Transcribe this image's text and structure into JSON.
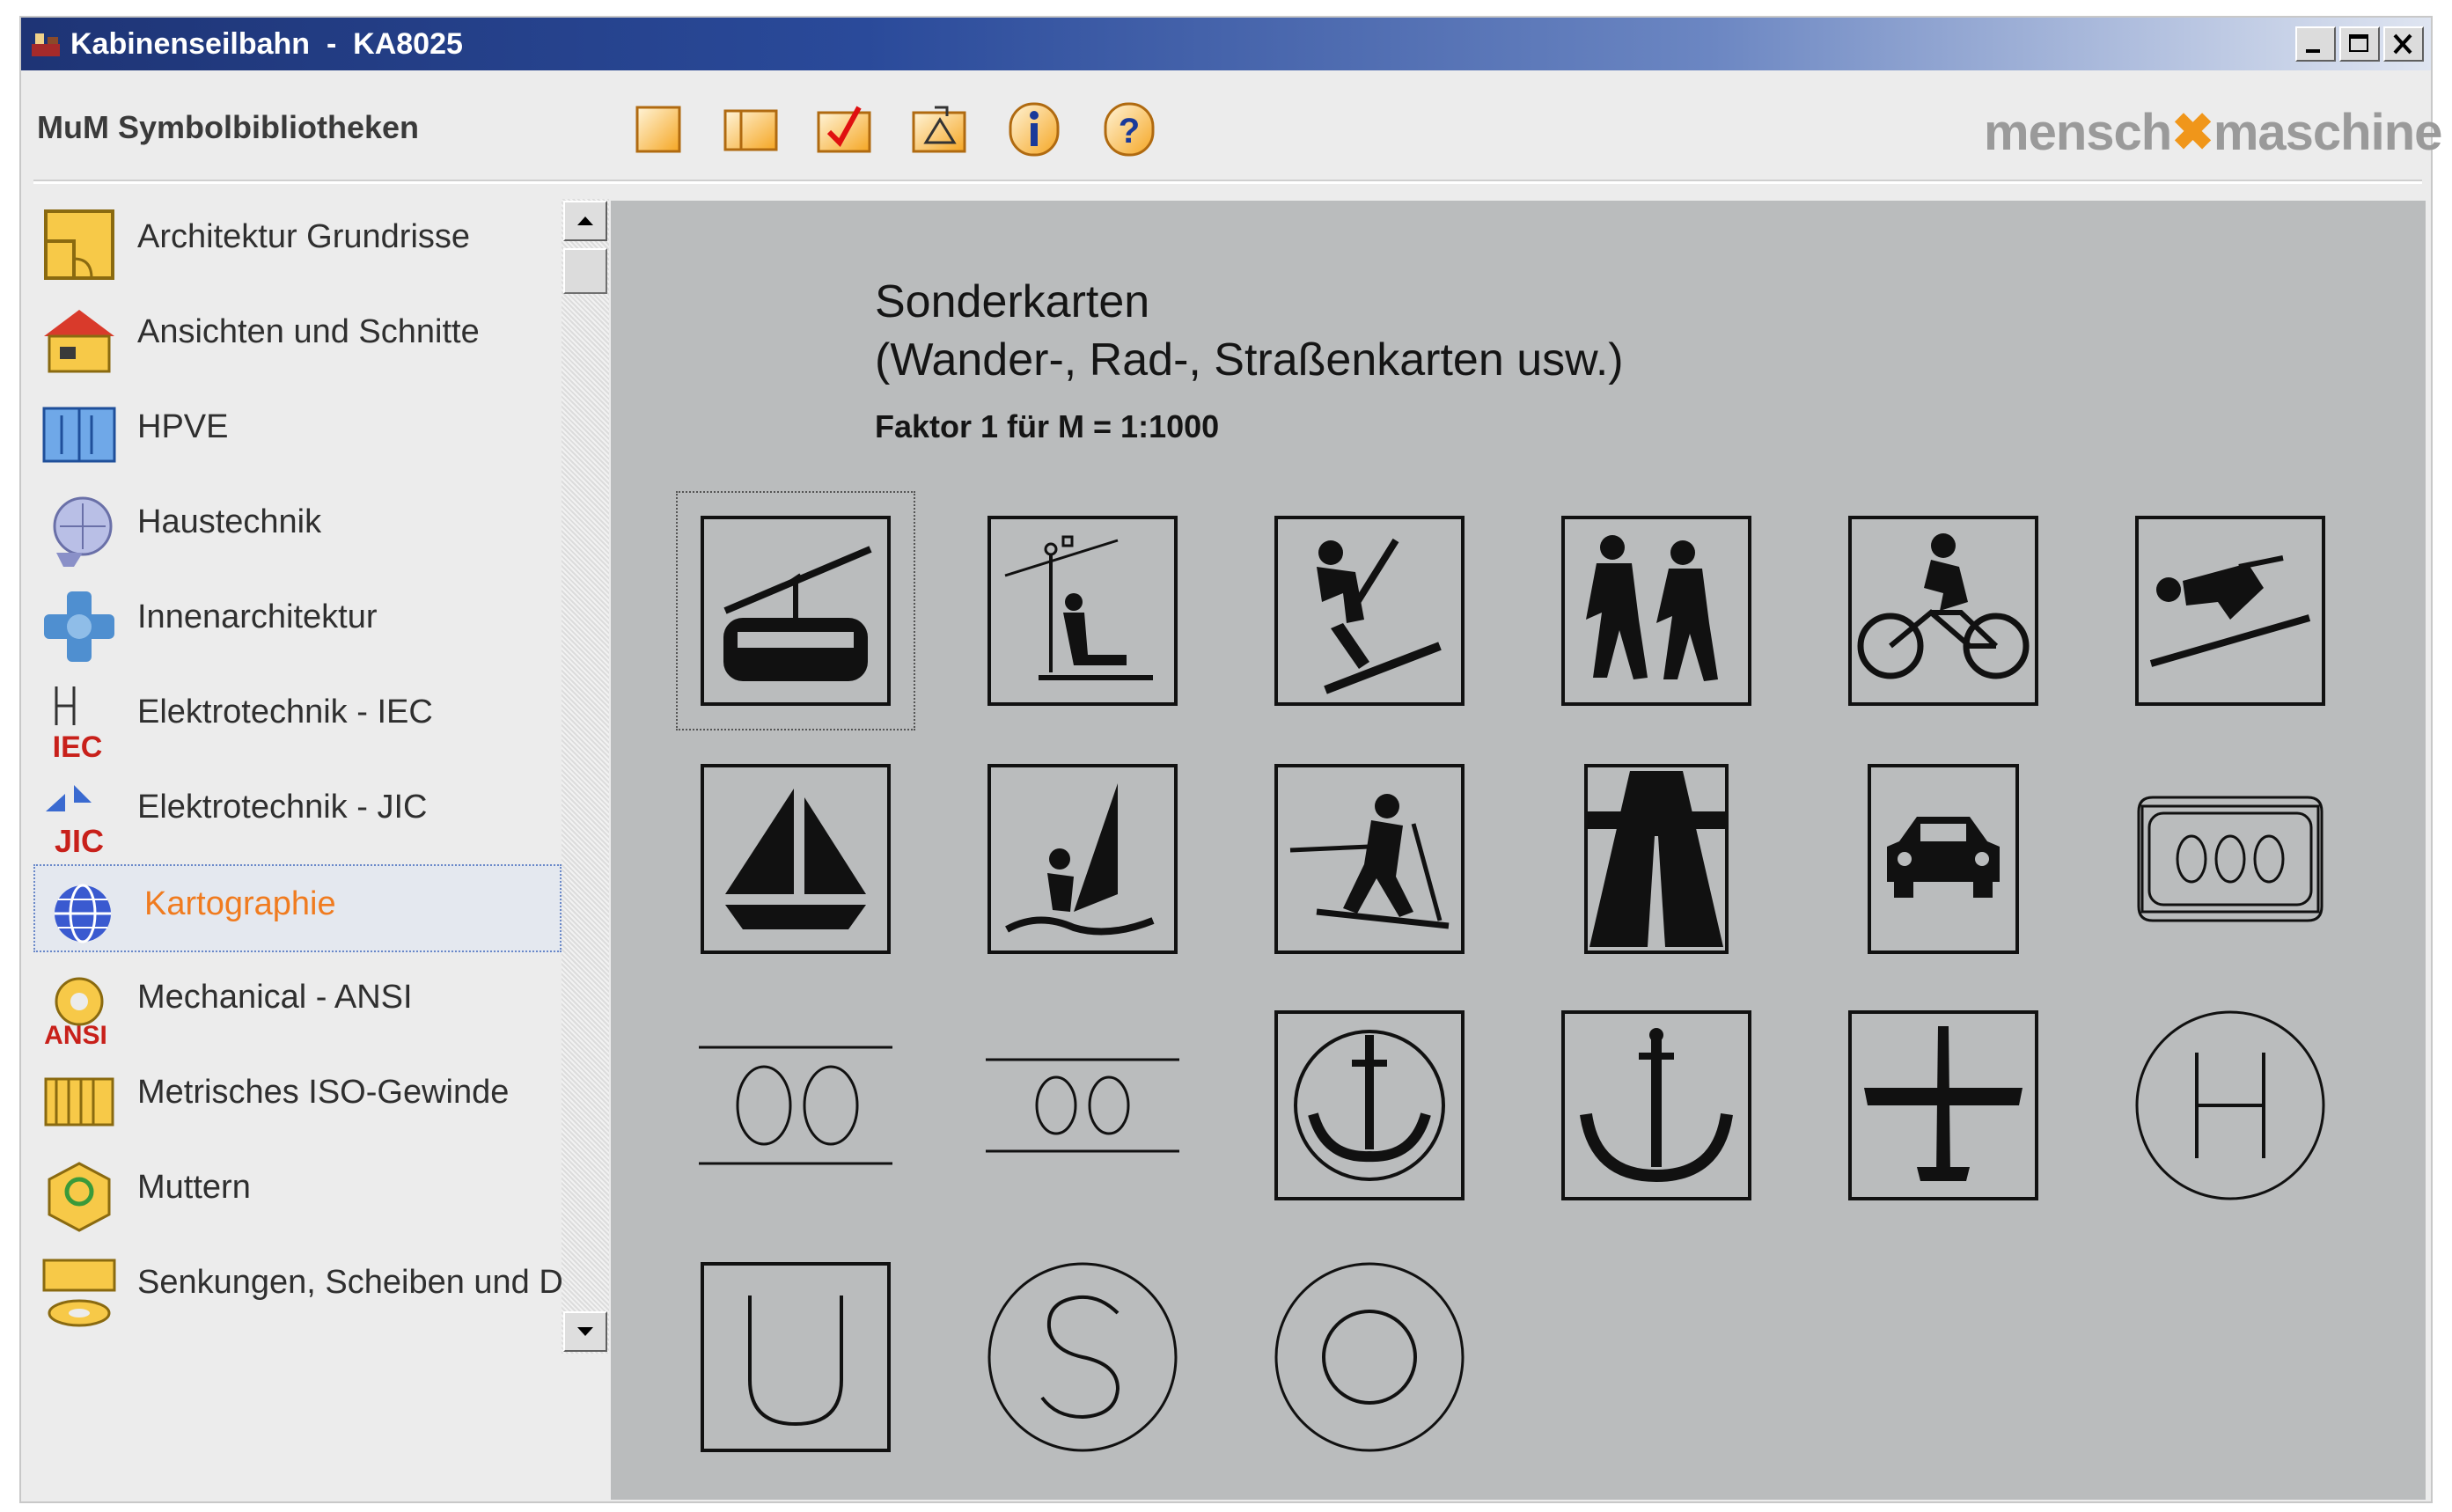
{
  "window": {
    "title": "Kabinenseilbahn  -  KA8025",
    "controls": {
      "minimize_icon": "minimize-icon",
      "maximize_icon": "maximize-icon",
      "close_icon": "close-icon"
    }
  },
  "toolbar": {
    "library_title": "MuM Symbolbibliotheken",
    "buttons": [
      "new-icon",
      "open-icon",
      "check-icon",
      "insert-icon",
      "info-icon",
      "help-icon"
    ],
    "logo_left": "mensch",
    "logo_right": "maschine",
    "accent_color": "#f0961a"
  },
  "sidebar": {
    "items": [
      {
        "label": "Architektur Grundrisse",
        "icon": "floorplan-icon"
      },
      {
        "label": "Ansichten und Schnitte",
        "icon": "house-icon"
      },
      {
        "label": "HPVE",
        "icon": "hpve-icon"
      },
      {
        "label": "Haustechnik",
        "icon": "hvac-icon"
      },
      {
        "label": "Innenarchitektur",
        "icon": "interior-icon"
      },
      {
        "label": "Elektrotechnik - IEC",
        "icon": "iec-icon",
        "badge": "IEC"
      },
      {
        "label": "Elektrotechnik - JIC",
        "icon": "jic-icon",
        "badge": "JIC"
      },
      {
        "label": "Kartographie",
        "icon": "globe-icon",
        "active": true
      },
      {
        "label": "Mechanical - ANSI",
        "icon": "gear-icon",
        "badge": "ANSI"
      },
      {
        "label": "Metrisches ISO-Gewinde",
        "icon": "thread-icon"
      },
      {
        "label": "Muttern",
        "icon": "nut-icon"
      },
      {
        "label": "Senkungen, Scheiben und Du",
        "icon": "washer-icon"
      }
    ],
    "active_color": "#f07b1f"
  },
  "main": {
    "heading": "Sonderkarten\n(Wander-, Rad-, Straßenkarten usw.)",
    "subheading": "Faktor 1 für M = 1:1000",
    "symbols": [
      "cable-car-symbol",
      "chairlift-symbol",
      "ski-jump-symbol",
      "hiking-symbol",
      "cycling-symbol",
      "downhill-ski-symbol",
      "sailing-symbol",
      "windsurfing-symbol",
      "cross-country-ski-symbol",
      "motorway-symbol",
      "car-symbol",
      "three-digit-road-sign-symbol",
      "two-digit-road-sign-symbol",
      "two-digit-road-sign-small-symbol",
      "anchor-circle-symbol",
      "anchor-symbol",
      "airport-symbol",
      "heliport-symbol",
      "u-bahn-symbol",
      "s-bahn-symbol",
      "o-circle-symbol"
    ],
    "selected_symbol": "cable-car-symbol"
  }
}
